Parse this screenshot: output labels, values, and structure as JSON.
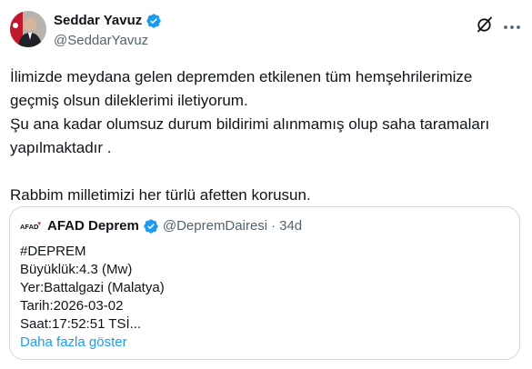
{
  "tweet": {
    "author": {
      "name": "Seddar Yavuz",
      "handle": "@SeddarYavuz"
    },
    "text_lines": [
      "İlimizde meydana gelen depremden etkilenen tüm hemşehrilerimize",
      "geçmiş olsun dileklerimi iletiyorum.",
      "Şu ana kadar olumsuz durum bildirimi alınmamış olup saha taramaları",
      "yapılmaktadır .",
      "",
      "Rabbim milletimizi her türlü afetten korusun."
    ]
  },
  "quote": {
    "logo_text": "AFAD",
    "name": "AFAD Deprem",
    "handle": "@DepremDairesi",
    "separator": "·",
    "time": "34d",
    "lines": [
      "#DEPREM",
      "Büyüklük:4.3 (Mw)",
      "Yer:Battalgazi (Malatya)",
      "Tarih:2026-03-02",
      "Saat:17:52:51 TSİ..."
    ],
    "show_more": "Daha fazla göster"
  },
  "icons": {
    "verified": "verified-badge-icon",
    "grok": "grok-icon",
    "more": "more-horizontal-icon"
  },
  "colors": {
    "verified": "#1d9bf0",
    "link": "#1d9bf0",
    "secondary_text": "#536471",
    "border": "#cfd9de",
    "afad_red": "#d2232a"
  }
}
